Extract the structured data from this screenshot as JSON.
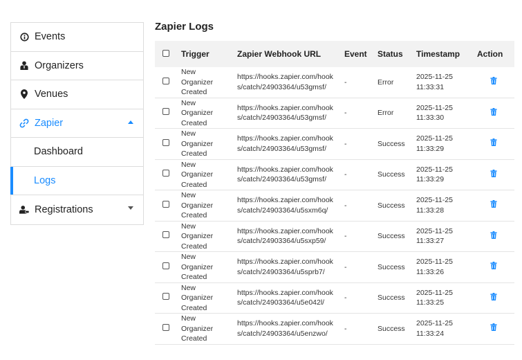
{
  "sidebar": {
    "items": [
      {
        "label": "Events",
        "icon": "info-circle-icon"
      },
      {
        "label": "Organizers",
        "icon": "user-tie-icon"
      },
      {
        "label": "Venues",
        "icon": "map-pin-icon"
      },
      {
        "label": "Zapier",
        "icon": "link-icon",
        "expanded": true
      },
      {
        "label": "Dashboard"
      },
      {
        "label": "Logs",
        "active": true
      },
      {
        "label": "Registrations",
        "icon": "user-badge-icon",
        "expanded": false
      }
    ]
  },
  "main": {
    "title": "Zapier Logs",
    "columns": [
      "Trigger",
      "Zapier Webhook URL",
      "Event",
      "Status",
      "Timestamp",
      "Action"
    ],
    "rows": [
      {
        "trigger": "New Organizer Created",
        "url": "https://hooks.zapier.com/hooks/catch/24903364/u53gmsf/",
        "event": "-",
        "status": "Error",
        "ts_date": "2025-11-25",
        "ts_time": "11:33:31"
      },
      {
        "trigger": "New Organizer Created",
        "url": "https://hooks.zapier.com/hooks/catch/24903364/u53gmsf/",
        "event": "-",
        "status": "Error",
        "ts_date": "2025-11-25",
        "ts_time": "11:33:30"
      },
      {
        "trigger": "New Organizer Created",
        "url": "https://hooks.zapier.com/hooks/catch/24903364/u53gmsf/",
        "event": "-",
        "status": "Success",
        "ts_date": "2025-11-25",
        "ts_time": "11:33:29"
      },
      {
        "trigger": "New Organizer Created",
        "url": "https://hooks.zapier.com/hooks/catch/24903364/u53gmsf/",
        "event": "-",
        "status": "Success",
        "ts_date": "2025-11-25",
        "ts_time": "11:33:29"
      },
      {
        "trigger": "New Organizer Created",
        "url": "https://hooks.zapier.com/hooks/catch/24903364/u5sxm6q/",
        "event": "-",
        "status": "Success",
        "ts_date": "2025-11-25",
        "ts_time": "11:33:28"
      },
      {
        "trigger": "New Organizer Created",
        "url": "https://hooks.zapier.com/hooks/catch/24903364/u5sxp59/",
        "event": "-",
        "status": "Success",
        "ts_date": "2025-11-25",
        "ts_time": "11:33:27"
      },
      {
        "trigger": "New Organizer Created",
        "url": "https://hooks.zapier.com/hooks/catch/24903364/u5sprb7/",
        "event": "-",
        "status": "Success",
        "ts_date": "2025-11-25",
        "ts_time": "11:33:26"
      },
      {
        "trigger": "New Organizer Created",
        "url": "https://hooks.zapier.com/hooks/catch/24903364/u5e042l/",
        "event": "-",
        "status": "Success",
        "ts_date": "2025-11-25",
        "ts_time": "11:33:25"
      },
      {
        "trigger": "New Organizer Created",
        "url": "https://hooks.zapier.com/hooks/catch/24903364/u5enzwo/",
        "event": "-",
        "status": "Success",
        "ts_date": "2025-11-25",
        "ts_time": "11:33:24"
      }
    ]
  },
  "colors": {
    "accent": "#1a8cff",
    "header_bg": "#f2f2f2",
    "border": "#dcdcdc"
  }
}
